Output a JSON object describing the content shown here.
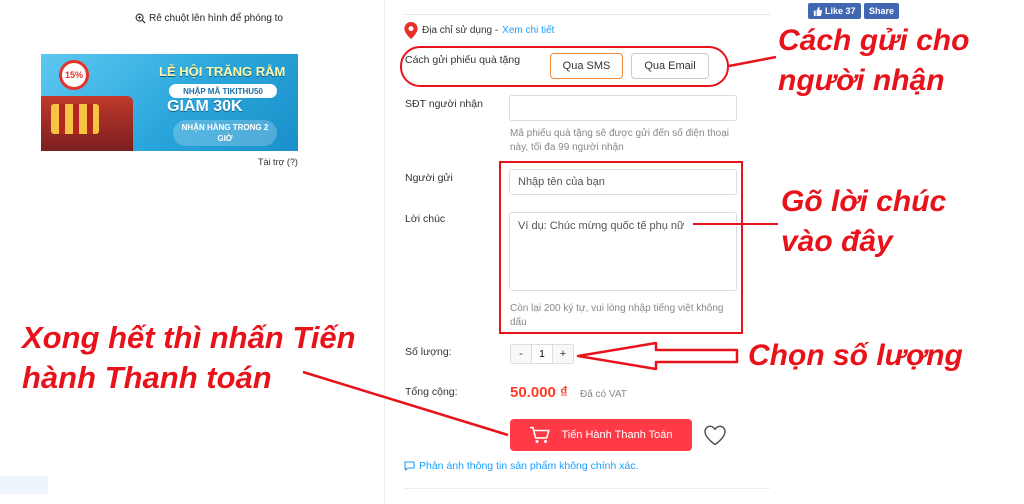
{
  "left": {
    "zoom_hint": "Rê chuột lên hình để phóng to",
    "banner": {
      "discount_badge": "15%",
      "title": "LỄ HỘI TRĂNG RẰM",
      "code": "NHẬP MÃ TIKITHU50",
      "amount": "GIẢM 30K",
      "delivery": "NHẬN HÀNG TRONG 2 GIỜ"
    },
    "sponsor": "Tài trợ (?)"
  },
  "social": {
    "like_label": "Like 37",
    "share_label": "Share"
  },
  "address": {
    "label": "Địa chỉ sử dụng - ",
    "link": "Xem chi tiết"
  },
  "form": {
    "send_method_label": "Cách gửi phiếu quà tặng",
    "sms_button": "Qua SMS",
    "email_button": "Qua Email",
    "phone_label": "SĐT người nhận",
    "phone_value": "",
    "phone_hint": "Mã phiếu quà tặng sẽ được gửi đến số điện thoại này, tối đa 99 người nhận",
    "sender_label": "Người gửi",
    "sender_placeholder": "Nhập tên của bạn",
    "message_label": "Lời chúc",
    "message_placeholder": "Ví dụ: Chúc mừng quốc tế phụ nữ",
    "message_hint": "Còn lại 200 ký tự, vui lòng nhập tiếng việt không dấu",
    "qty_label": "Số lượng:",
    "qty_minus": "-",
    "qty_value": "1",
    "qty_plus": "+",
    "total_label": "Tổng cộng:",
    "total_price": "50.000 ₫",
    "vat_note": "Đã có VAT",
    "checkout_button": "Tiến Hành Thanh Toán",
    "report_link": "Phản ánh thông tin sản phẩm không chính xác."
  },
  "annotations": {
    "send_method_line1": "Cách gửi cho",
    "send_method_line2": "người nhận",
    "message_line1": "Gõ lời chúc",
    "message_line2": "vào đây",
    "qty_note": "Chọn số lượng",
    "checkout_line1": "Xong hết thì nhấn Tiến",
    "checkout_line2": "hành Thanh toán"
  },
  "colors": {
    "annotation_red": "#e8121b",
    "checkout_red": "#ff3945",
    "price_red": "#ff3b27",
    "link_blue": "#189eff",
    "sms_border": "#f08a3c",
    "facebook_blue": "#4267b2"
  }
}
